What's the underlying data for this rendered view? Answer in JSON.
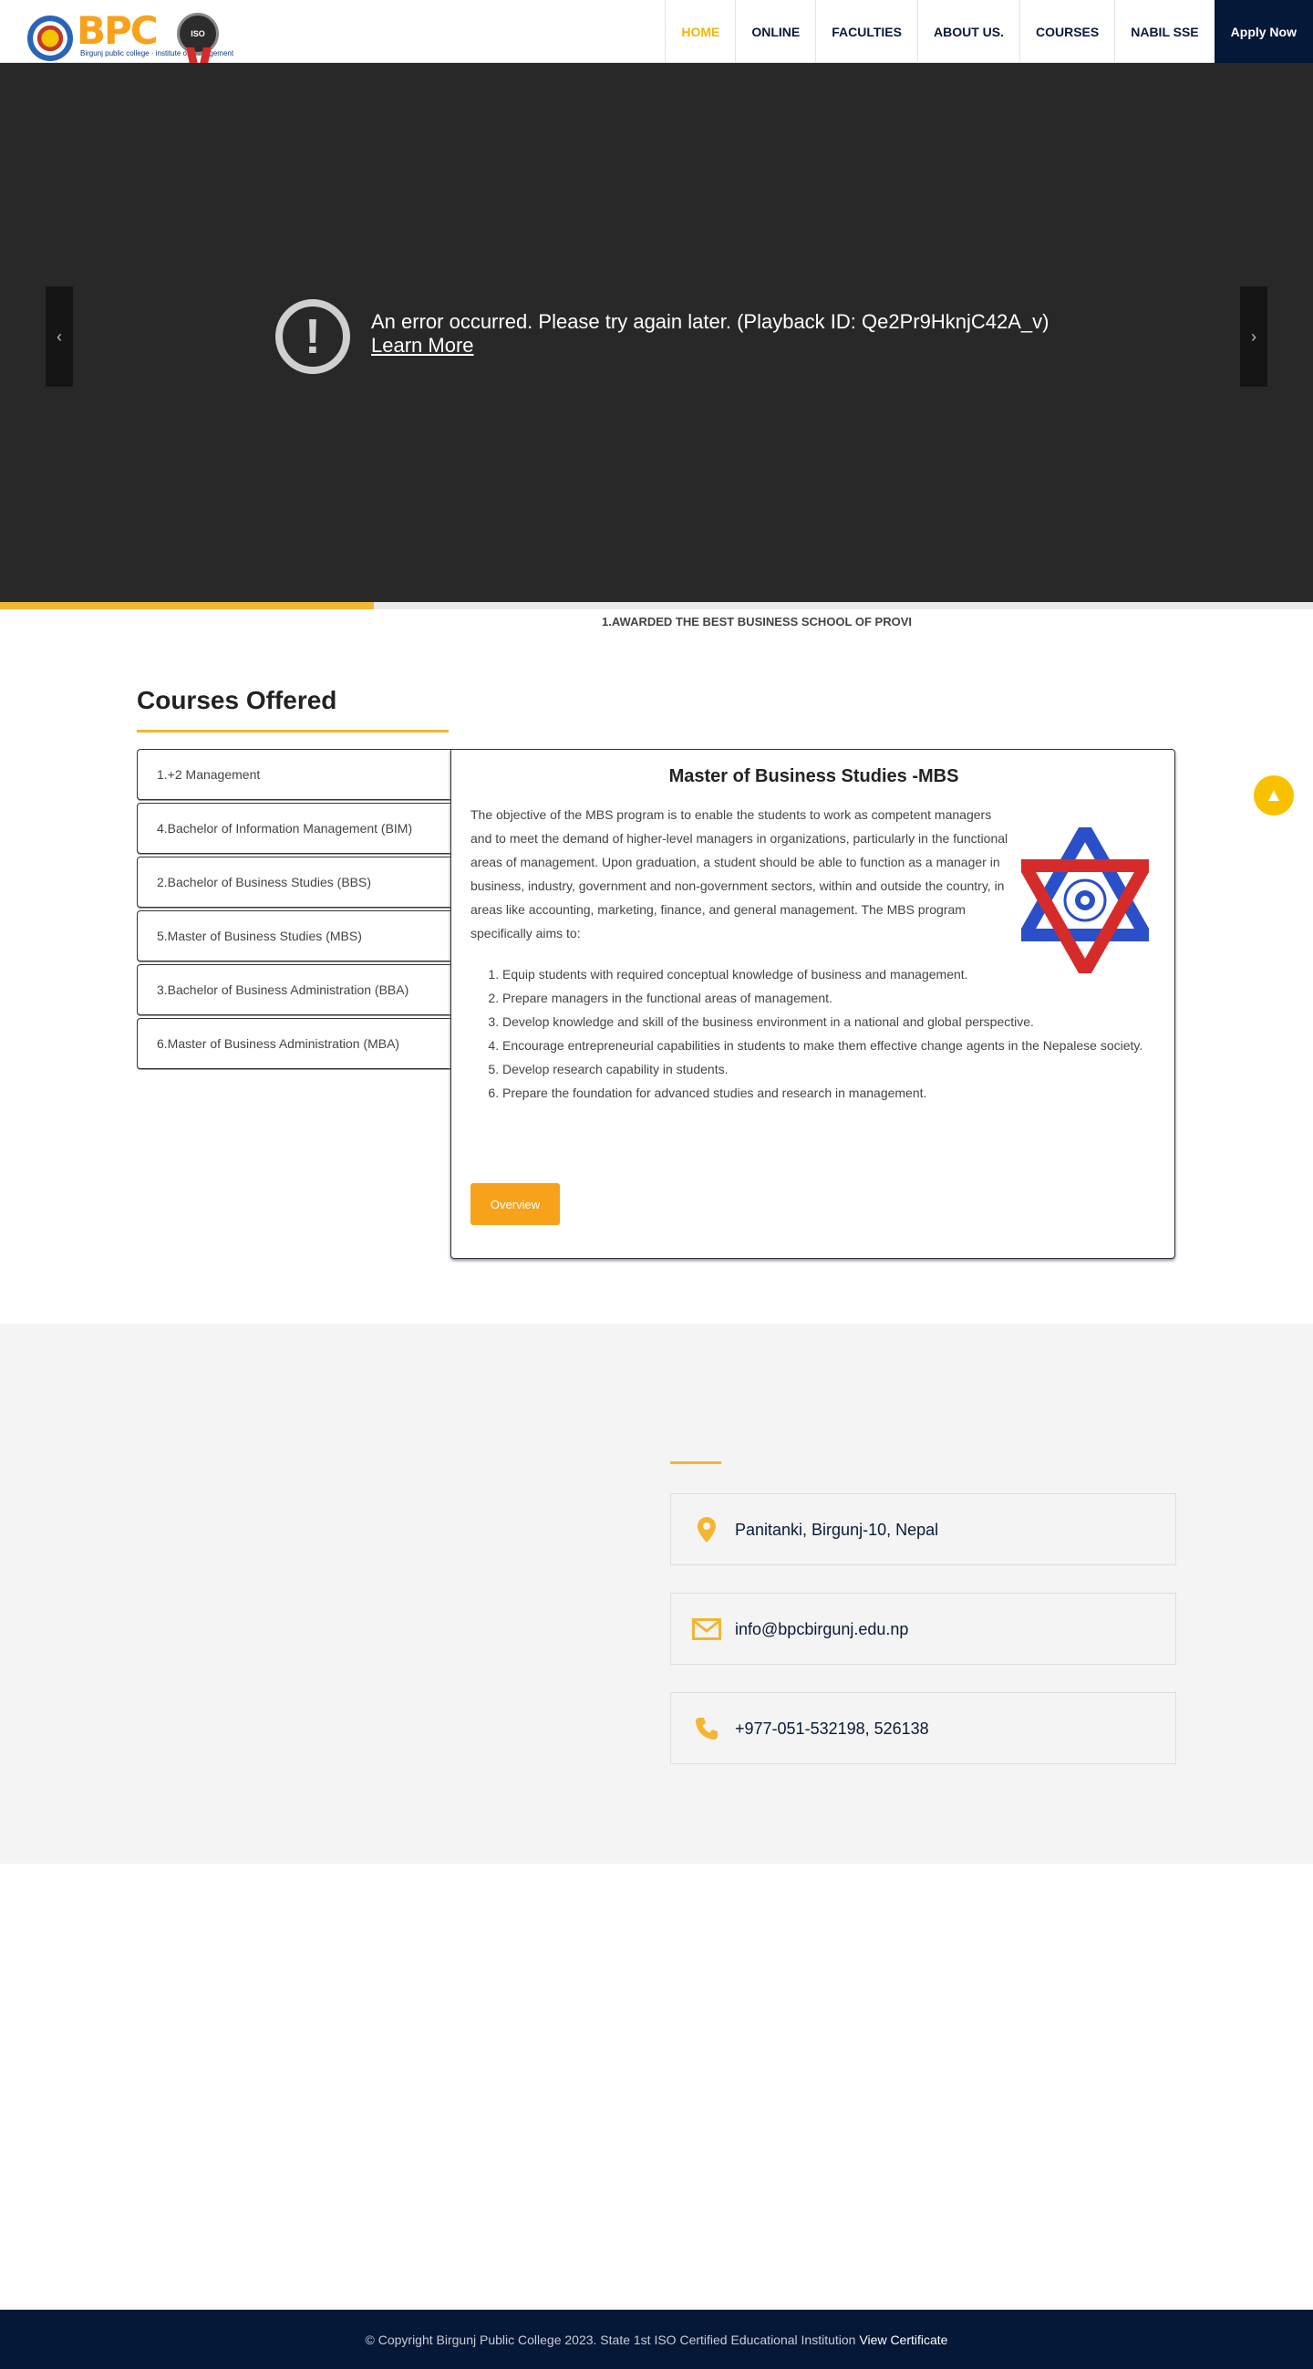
{
  "header": {
    "logo": {
      "brand": "BPC",
      "sub": "Birgunj public college · institute of management",
      "iso": "ISO"
    },
    "nav": [
      {
        "label": "HOME",
        "active": true
      },
      {
        "label": "ONLINE"
      },
      {
        "label": "FACULTIES"
      },
      {
        "label": "ABOUT US."
      },
      {
        "label": "COURSES"
      },
      {
        "label": "NABIL SSE"
      }
    ],
    "apply_label": "Apply Now"
  },
  "hero": {
    "error_message": "An error occurred. Please try again later. (Playback ID: Qe2Pr9HknjC42A_v)",
    "learn_more": "Learn More",
    "progress": 0.285
  },
  "marquee": {
    "text": "1.AWARDED THE BEST BUSINESS SCHOOL OF PROVI"
  },
  "courses": {
    "title": "Courses Offered",
    "tabs": [
      "1.+2 Management",
      "4.Bachelor of Information Management (BIM)",
      "2.Bachelor of Business Studies (BBS)",
      "5.Master of Business Studies (MBS)",
      "3.Bachelor of Business Administration (BBA)",
      "6.Master of Business Administration (MBA)"
    ],
    "panel": {
      "title": "Master of Business Studies -MBS",
      "description": "The objective of the MBS program is to enable the students to work as competent managers and to meet the demand of higher-level managers in organizations, particularly in the functional areas of management. Upon graduation, a student should be able to function as a manager in business, industry, government and non-government sectors, within and outside the country, in areas like accounting, marketing, finance, and general management. The MBS program specifically aims to:",
      "aims": [
        "Equip students with required conceptual knowledge of business and management.",
        "Prepare managers in the functional areas of management.",
        "Develop knowledge and skill of the business environment in a national and global perspective.",
        "Encourage entrepreneurial capabilities in students to make them effective change agents in the Nepalese society.",
        "Develop research capability in students.",
        "Prepare the foundation for advanced studies and research in management."
      ],
      "overview_label": "Overview"
    }
  },
  "contact": {
    "address": "Panitanki, Birgunj-10, Nepal",
    "email": "info@bpcbirgunj.edu.np",
    "phone": "+977-051-532198, 526138"
  },
  "footer": {
    "copyright": "© Copyright Birgunj Public College 2023. State 1st ISO Certified Educational Institution",
    "certificate_link": "View Certificate"
  },
  "colors": {
    "accent": "#f2b632",
    "navy": "#061838",
    "button": "#f7a21b"
  }
}
